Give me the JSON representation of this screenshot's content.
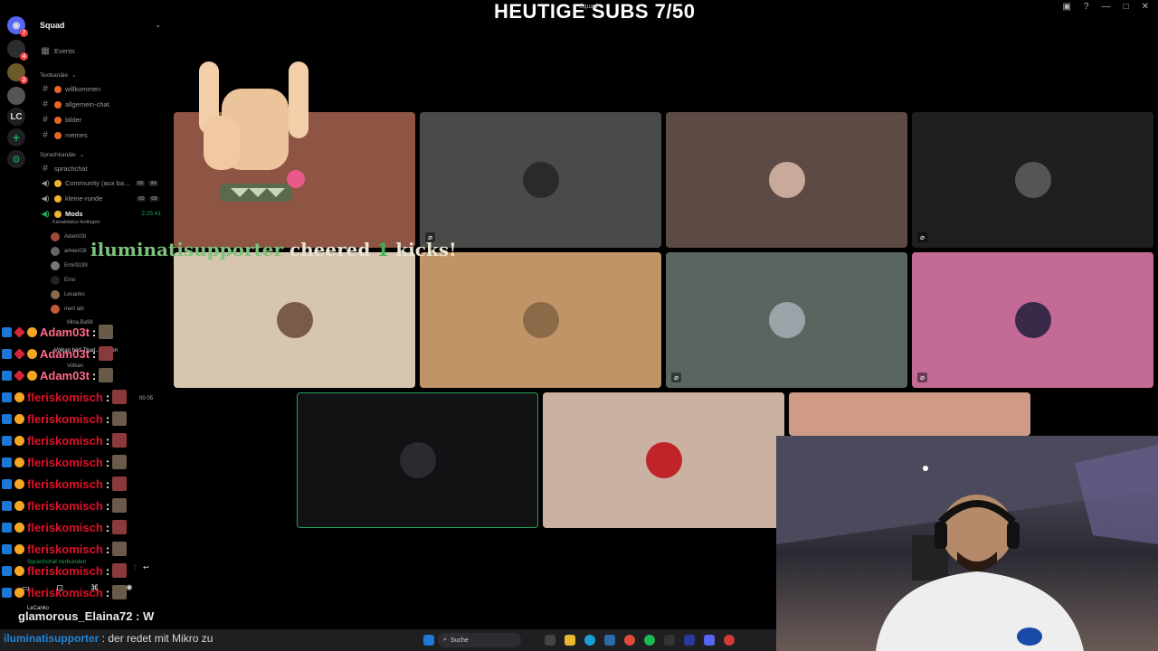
{
  "overlay": {
    "title": "HEUTIGE SUBS 7/50",
    "cheer": {
      "name": "iluminatisupporter",
      "verb": "cheered",
      "amount": "1",
      "unit": "kicks!"
    }
  },
  "window": {
    "title_small": "Squad"
  },
  "server": {
    "name": "Squad",
    "events_label": "Events",
    "text_category": "Textkanäle",
    "text_channels": [
      "willkommen",
      "allgemein-chat",
      "bilder",
      "memes"
    ],
    "voice_category": "Sprachkanäle",
    "voice_channels": [
      {
        "name": "sprachchat"
      },
      {
        "name": "Community (aux ba...",
        "count_a": "00",
        "count_b": "99"
      },
      {
        "name": "kleine-runde",
        "count_a": "00",
        "count_b": "09"
      },
      {
        "name": "Mods",
        "timer": "2:25:41",
        "status": "Kanalstatus festlegen"
      }
    ],
    "voice_users": [
      "Adam03t",
      "amien03t",
      "Emir9199",
      "Emo",
      "Lecanko",
      "mert abi",
      "Mina.Ba98",
      "Volkan"
    ],
    "activity": "Volkan hört Thad... Fusion",
    "extra_counts": {
      "a": "00",
      "b": "05"
    },
    "voice_connected": "Sprachchat verbunden",
    "current_user": "LeCanko"
  },
  "chat": {
    "messages": [
      {
        "name": "Adam03t",
        "color": "#ff6b8a"
      },
      {
        "name": "Adam03t",
        "color": "#ff6b8a"
      },
      {
        "name": "Adam03t",
        "color": "#ff6b8a"
      },
      {
        "name": "fleriskomisch",
        "color": "#e0102a"
      },
      {
        "name": "fleriskomisch",
        "color": "#e0102a"
      },
      {
        "name": "fleriskomisch",
        "color": "#e0102a"
      },
      {
        "name": "fleriskomisch",
        "color": "#e0102a"
      },
      {
        "name": "fleriskomisch",
        "color": "#e0102a"
      },
      {
        "name": "fleriskomisch",
        "color": "#e0102a"
      },
      {
        "name": "fleriskomisch",
        "color": "#e0102a"
      },
      {
        "name": "fleriskomisch",
        "color": "#e0102a"
      },
      {
        "name": "fleriskomisch",
        "color": "#e0102a"
      },
      {
        "name": "fleriskomisch",
        "color": "#e0102a"
      }
    ],
    "glam": "glamorous_Elaina72 : W",
    "bottom": {
      "name": "iluminatisupporter",
      "message": ": der redet mit Mikro zu"
    }
  },
  "taskbar": {
    "search_placeholder": "Suche"
  },
  "colors": {
    "tile_brown": "#8e5444",
    "tile_gray": "#4a4a48",
    "tile_taupe": "#5c4a44",
    "tile_dark": "#1f1f1f",
    "tile_cream": "#d6c6b0",
    "tile_tan": "#c09466",
    "tile_slate": "#5a6560",
    "tile_pink": "#c46a96",
    "tile_black": "#121214",
    "tile_pale": "#cbb1a1",
    "tile_peach": "#cf9a86",
    "speaking_border": "#23a55a"
  }
}
